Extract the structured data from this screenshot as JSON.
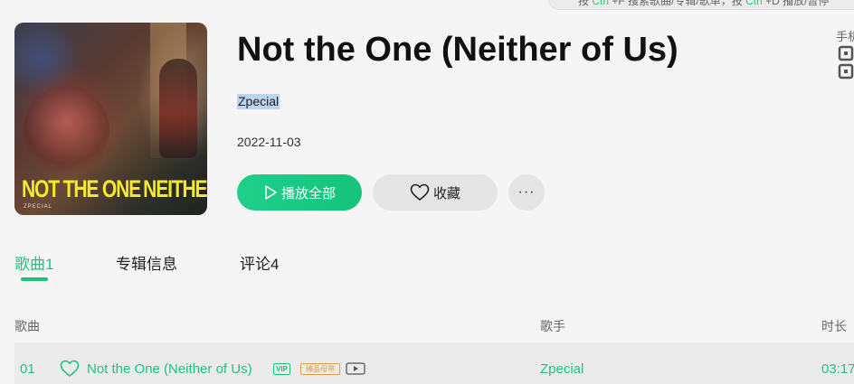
{
  "hint_banner": {
    "prefix": "按",
    "key1": "Ctrl",
    "text1": "+F 搜索歌曲/专辑/歌单，按",
    "key2": "Ctrl",
    "text2": "+D 播放/暂停"
  },
  "album": {
    "cover_text_left": "NOT THE ONE",
    "cover_text_right": "NEITHER OF US",
    "cover_artist": "ZPECIAL",
    "title": "Not the One (Neither of Us)",
    "artist": "Zpecial",
    "release_date": "2022-11-03"
  },
  "actions": {
    "play_all": "播放全部",
    "favorite": "收藏",
    "more": "···"
  },
  "phone_hint": "手机",
  "tabs": [
    {
      "label": "歌曲1",
      "active": true
    },
    {
      "label": "专辑信息",
      "active": false
    },
    {
      "label": "评论4",
      "active": false
    }
  ],
  "table": {
    "headers": {
      "song": "歌曲",
      "singer": "歌手",
      "duration": "时长"
    },
    "rows": [
      {
        "index": "01",
        "name": "Not the One (Neither of Us)",
        "badges": [
          "VIP",
          "臻品母带"
        ],
        "singer": "Zpecial",
        "duration": "03:17"
      }
    ]
  },
  "colors": {
    "accent": "#1ec47e",
    "background": "#f5f5f5",
    "button_gray": "#e5e5e5",
    "selection": "#bcd3f2"
  }
}
